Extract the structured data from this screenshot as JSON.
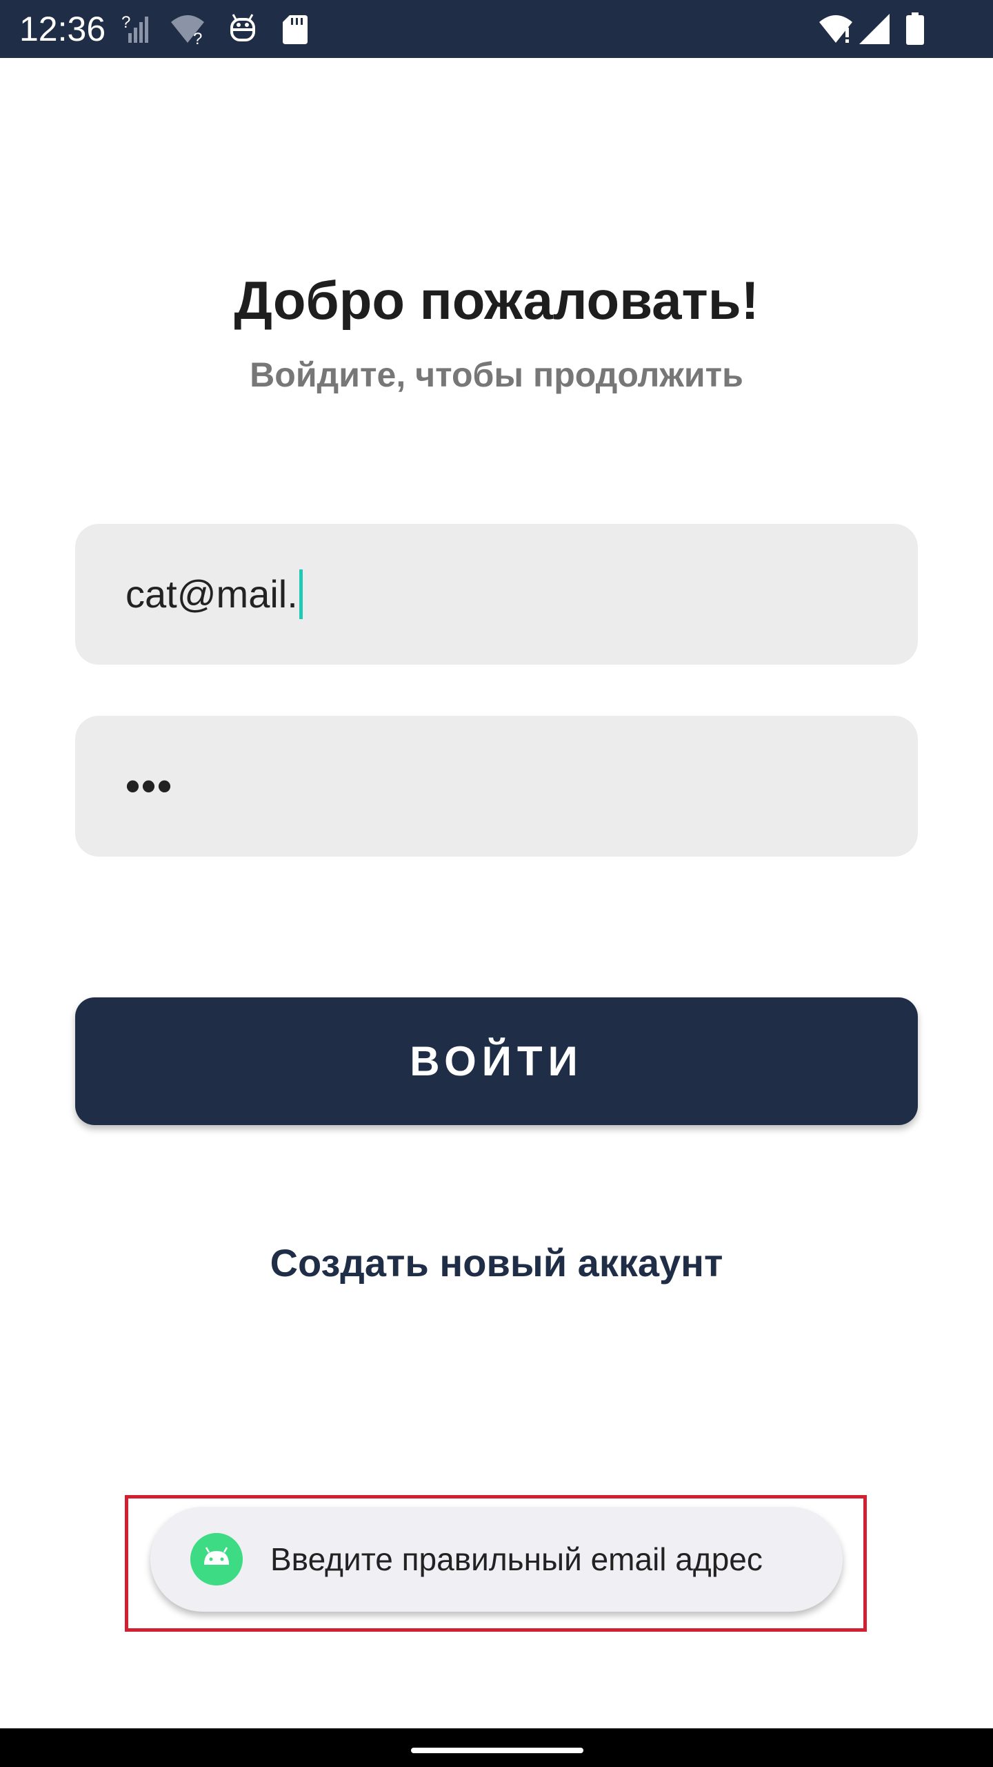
{
  "status_bar": {
    "time": "12:36",
    "icons": [
      "signal-unknown-icon",
      "wifi-unknown-icon",
      "robot-icon",
      "sd-card-icon",
      "wifi-icon",
      "cell-signal-icon",
      "battery-icon"
    ],
    "background": "#1f2d47"
  },
  "login": {
    "title": "Добро пожаловать!",
    "subtitle": "Войдите, чтобы продолжить",
    "email_value": "cat@mail.",
    "password_value": "•••",
    "login_button": "ВОЙТИ",
    "create_account_link": "Создать новый аккаунт"
  },
  "toast": {
    "message": "Введите правильный email адрес",
    "icon": "android-icon"
  },
  "colors": {
    "primary": "#1f2d47",
    "field_bg": "#ececec",
    "caret": "#1ec9b5",
    "highlight": "#d32030",
    "android_green": "#3ddc84"
  }
}
